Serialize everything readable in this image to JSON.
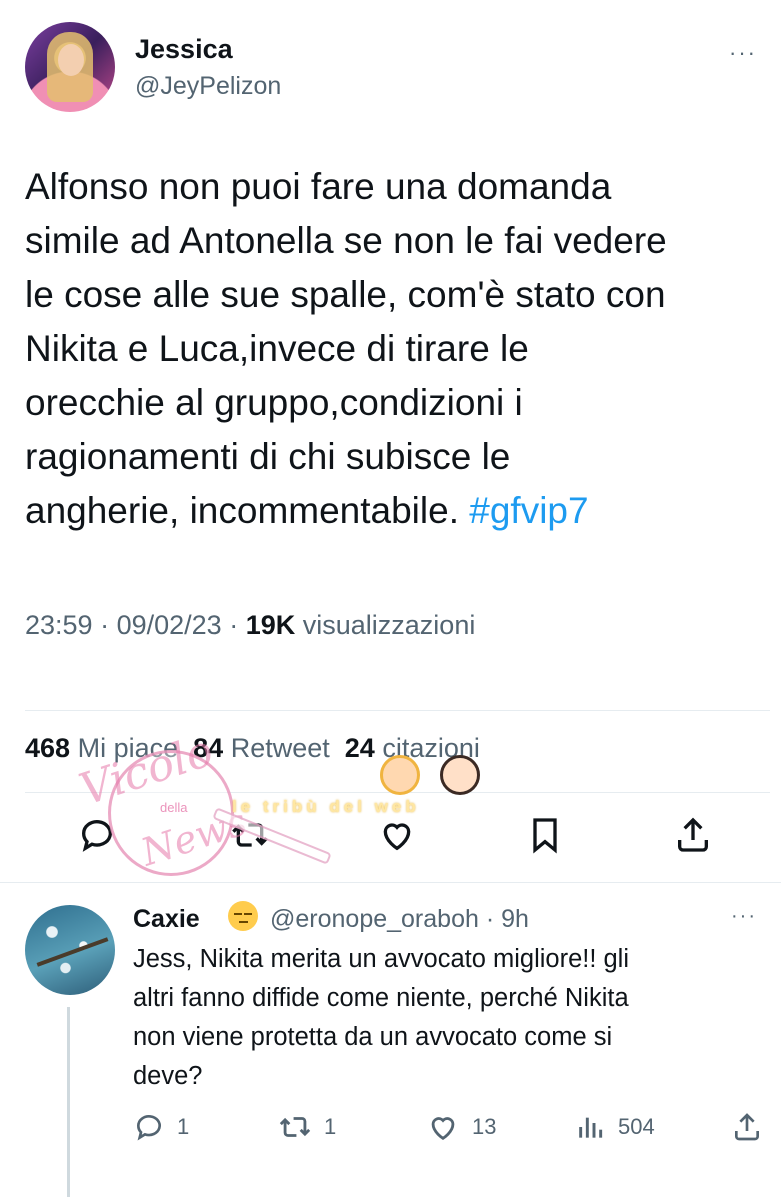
{
  "tweet": {
    "name": "Jessica",
    "handle": "@JeyPelizon",
    "more": "···",
    "lines": [
      "Alfonso non puoi fare una domanda",
      "simile ad Antonella se non le fai vedere",
      "le cose alle sue spalle, com'è stato con",
      "Nikita e Luca,invece di tirare le",
      "orecchie al gruppo,condizioni i",
      "ragionamenti di chi subisce le",
      "angherie, incommentabile."
    ],
    "hashtag": "#gfvip7",
    "time": "23:59",
    "date": "09/02/23",
    "views_count": "19K",
    "views_label": "visualizzazioni",
    "likes_count": "468",
    "likes_label": "Mi piace",
    "retweets_count": "84",
    "retweets_label": "Retweet",
    "quotes_count": "24",
    "quotes_label": "citazioni"
  },
  "reply": {
    "name": "Caxie",
    "emoji": "unamused-face",
    "handle_time": "@eronope_oraboh · 9h",
    "more": "···",
    "lines": [
      "Jess, Nikita merita un avvocato migliore!! gli",
      "altri fanno diffide come niente, perché Nikita",
      "non viene protetta da un avvocato come si",
      "deve?"
    ],
    "replies": "1",
    "retweets": "1",
    "likes": "13",
    "views": "504"
  },
  "watermark": {
    "script1": "Vicolo",
    "small": "della",
    "script2": "News",
    "band": "le tribù del web"
  },
  "colors": {
    "text": "#0f1419",
    "secondary": "#536471",
    "link": "#1d9bf0",
    "divider": "#e6ecf0"
  },
  "icons": [
    "reply-icon",
    "retweet-icon",
    "like-icon",
    "bookmark-icon",
    "share-icon",
    "views-icon"
  ]
}
